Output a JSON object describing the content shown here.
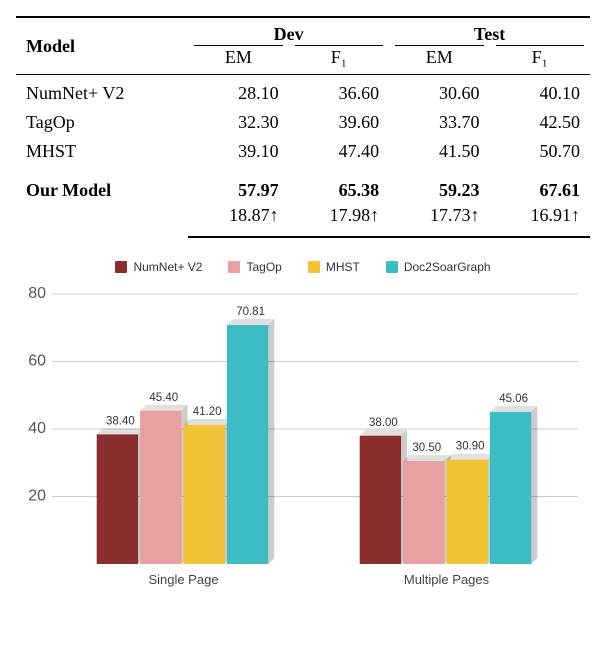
{
  "table": {
    "head": {
      "model": "Model",
      "dev": "Dev",
      "test": "Test",
      "sub": {
        "em": "EM",
        "f1": "F₁"
      }
    },
    "rows": [
      {
        "model": "NumNet+ V2",
        "dev_em": "28.10",
        "dev_f1": "36.60",
        "test_em": "30.60",
        "test_f1": "40.10"
      },
      {
        "model": "TagOp",
        "dev_em": "32.30",
        "dev_f1": "39.60",
        "test_em": "33.70",
        "test_f1": "42.50"
      },
      {
        "model": "MHST",
        "dev_em": "39.10",
        "dev_f1": "47.40",
        "test_em": "41.50",
        "test_f1": "50.70"
      }
    ],
    "our": {
      "label": "Our Model",
      "dev_em": "57.97",
      "dev_f1": "65.38",
      "test_em": "59.23",
      "test_f1": "67.61",
      "d_dev_em": "18.87↑",
      "d_dev_f1": "17.98↑",
      "d_test_em": "17.73↑",
      "d_test_f1": "16.91↑"
    }
  },
  "chart_data": {
    "type": "bar",
    "categories": [
      "Single Page",
      "Multiple Pages"
    ],
    "series": [
      {
        "name": "NumNet+ V2",
        "values": [
          38.4,
          38.0
        ],
        "color": "#8b2e2e"
      },
      {
        "name": "TagOp",
        "values": [
          45.4,
          30.5
        ],
        "color": "#e8a0a0"
      },
      {
        "name": "MHST",
        "values": [
          41.2,
          30.9
        ],
        "color": "#f2c335"
      },
      {
        "name": "Doc2SoarGraph",
        "values": [
          70.81,
          45.06
        ],
        "color": "#3dbcc4"
      }
    ],
    "ylim": [
      0,
      80
    ],
    "yticks": [
      20,
      40,
      60,
      80
    ],
    "legend_position": "top",
    "grid": true,
    "xlabel": "",
    "ylabel": "",
    "title": ""
  },
  "legend": {
    "s0": "NumNet+ V2",
    "s1": "TagOp",
    "s2": "MHST",
    "s3": "Doc2SoarGraph"
  }
}
